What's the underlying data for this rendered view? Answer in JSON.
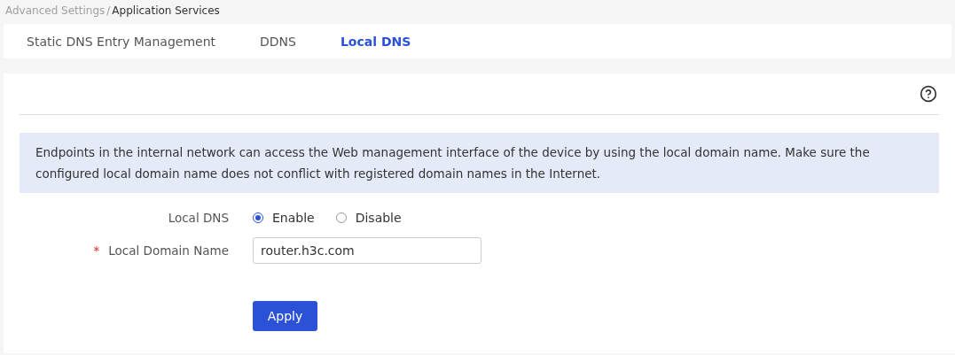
{
  "breadcrumb": {
    "parent": "Advanced Settings",
    "separator": "/",
    "current": "Application Services"
  },
  "tabs": [
    {
      "label": "Static DNS Entry Management",
      "selected": false
    },
    {
      "label": "DDNS",
      "selected": false
    },
    {
      "label": "Local DNS",
      "selected": true
    }
  ],
  "notice": "Endpoints in the internal network can access the Web management interface of the device by using the local domain name. Make sure the configured local domain name does not conflict with registered domain names in the Internet.",
  "form": {
    "local_dns": {
      "label": "Local DNS",
      "options": [
        {
          "label": "Enable",
          "selected": true
        },
        {
          "label": "Disable",
          "selected": false
        }
      ]
    },
    "domain": {
      "required_mark": "*",
      "label": "Local Domain Name",
      "value": "router.h3c.com"
    },
    "apply": "Apply"
  }
}
